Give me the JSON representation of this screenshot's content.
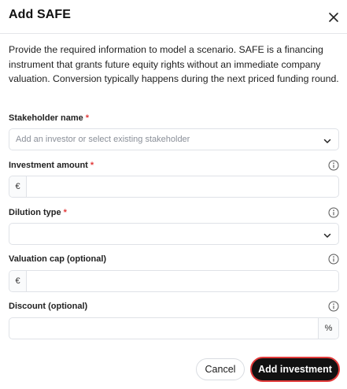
{
  "dialog": {
    "title": "Add SAFE",
    "description": "Provide the required information to model a scenario. SAFE is a financing instrument that grants future equity rights without an immediate company valuation. Conversion typically happens during the next priced funding round."
  },
  "fields": {
    "stakeholder": {
      "label": "Stakeholder name",
      "required_mark": "*",
      "placeholder": "Add an investor or select existing stakeholder",
      "value": ""
    },
    "investment": {
      "label": "Investment amount",
      "required_mark": "*",
      "prefix": "€",
      "value": ""
    },
    "dilution": {
      "label": "Dilution type",
      "required_mark": "*",
      "value": ""
    },
    "valuation_cap": {
      "label": "Valuation cap (optional)",
      "prefix": "€",
      "value": ""
    },
    "discount": {
      "label": "Discount (optional)",
      "suffix": "%",
      "value": ""
    }
  },
  "actions": {
    "cancel_label": "Cancel",
    "add_label": "Add investment"
  },
  "icons": {
    "close": "close-icon",
    "info": "info-icon",
    "chevron": "chevron-down-icon"
  },
  "colors": {
    "required": "#e23b3b",
    "primary_button": "#111111",
    "focus_ring": "#e23b3b"
  }
}
